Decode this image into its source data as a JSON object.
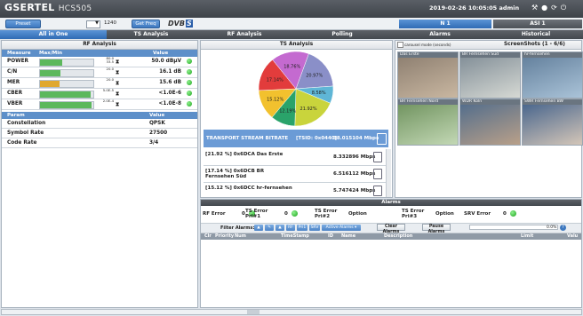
{
  "app": {
    "brand": "GSERTEL",
    "model": "HCS505",
    "datetime": "2019-02-26 10:05:05",
    "user": "admin"
  },
  "toolbar": {
    "preset_label": "Preset",
    "freq_value": "1240",
    "get_freq_label": "Get Freq",
    "dvb_logo": "DVB",
    "dvb_suffix": "S",
    "tab_n1": "N 1",
    "tab_asi1": "ASI 1"
  },
  "tabs": [
    "All in One",
    "TS Analysis",
    "RF Analysis",
    "Polling",
    "Alarms",
    "Historical"
  ],
  "rf": {
    "title": "RF Analysis",
    "headers": {
      "measure": "Measure",
      "maxmin": "Max/Min",
      "value": "Value"
    },
    "rows": [
      {
        "name": "POWER",
        "max": "80.0",
        "min": "33.5",
        "value": "50.0 dBµV",
        "bar": 0.42,
        "color": "#5cb85c"
      },
      {
        "name": "C/N",
        "max": "",
        "min": "20.0",
        "value": "16.1 dB",
        "bar": 0.38,
        "color": "#5cb85c"
      },
      {
        "name": "MER",
        "max": "",
        "min": "20.0",
        "value": "15.6 dB",
        "bar": 0.36,
        "color": "#e0a82e"
      },
      {
        "name": "CBER",
        "max": "",
        "min": "5.0E-5",
        "value": "<1.0E-6",
        "bar": 0.95,
        "color": "#5cb85c"
      },
      {
        "name": "VBER",
        "max": "",
        "min": "2.0E-4",
        "value": "<1.0E-8",
        "bar": 0.96,
        "color": "#5cb85c"
      }
    ],
    "param_headers": {
      "param": "Param",
      "value": "Value"
    },
    "params": [
      {
        "name": "Constellation",
        "value": "QPSK"
      },
      {
        "name": "Symbol Rate",
        "value": "27500"
      },
      {
        "name": "Code Rate",
        "value": "3/4"
      }
    ]
  },
  "ts": {
    "title": "TS Analysis",
    "pie": [
      {
        "label": "20.97%",
        "value": 20.97,
        "color": "#8a8fc8"
      },
      {
        "label": "8.58%",
        "value": 8.58,
        "color": "#5fb6d6"
      },
      {
        "label": "21.92%",
        "value": 21.92,
        "color": "#c9d43c"
      },
      {
        "label": "12.19%",
        "value": 12.19,
        "color": "#2aa36a"
      },
      {
        "label": "15.12%",
        "value": 15.12,
        "color": "#f2c12e"
      },
      {
        "label": "17.14%",
        "value": 17.14,
        "color": "#e23c3c"
      },
      {
        "label": "18.76%",
        "value": 18.76,
        "color": "#c46ad0"
      }
    ],
    "bitrate_label": "TRANSPORT STREAM BITRATE",
    "tsid": "[TSID: 0x0440]",
    "bitrate": "38.015104 Mbps",
    "services": [
      {
        "name": "[21.92 %] 0x6DCA Das Erste",
        "rate": "8.332896 Mbps"
      },
      {
        "name": "[17.14 %] 0x6DCB BR Fernsehen Süd",
        "rate": "6.516112 Mbps"
      },
      {
        "name": "[15.12 %] 0x6DCC hr-fernsehen",
        "rate": "5.747424 Mbps"
      }
    ]
  },
  "screens": {
    "title": "ScreenShots (1 - 6/6)",
    "carousel_label": "carousel mode (seconds)",
    "items": [
      "Das Erste",
      "BR Fernsehen Süd",
      "hr-fernsehen",
      "BR Fernsehen Nord",
      "WDR Köln",
      "SWR Fernsehen BW"
    ]
  },
  "alarms": {
    "title": "Alarms",
    "items": [
      {
        "label": "RF Error",
        "count": "0"
      },
      {
        "label": "TS Error Pri#1",
        "count": "0"
      },
      {
        "label": "TS Error Pri#2",
        "count": "Option"
      },
      {
        "label": "TS Error Pri#3",
        "count": "Option"
      },
      {
        "label": "SRV Error",
        "count": "0"
      }
    ],
    "filter_label": "Filter Alarms:",
    "filter_buttons": [
      "RF",
      "Pri1",
      "SRV"
    ],
    "active_label": "Active Alarms",
    "clear_label": "Clear Alarms",
    "pause_label": "Pause Alarms",
    "percent": "0.0%",
    "percent_value": 0,
    "columns": [
      "Clr",
      "Priority",
      "Num",
      "TimeStamp",
      "ID",
      "Name",
      "Description",
      "Limit",
      "Valu"
    ]
  },
  "colors": {
    "accent": "#3d78bf",
    "header": "#4a4f55",
    "ok": "#1da41d"
  }
}
